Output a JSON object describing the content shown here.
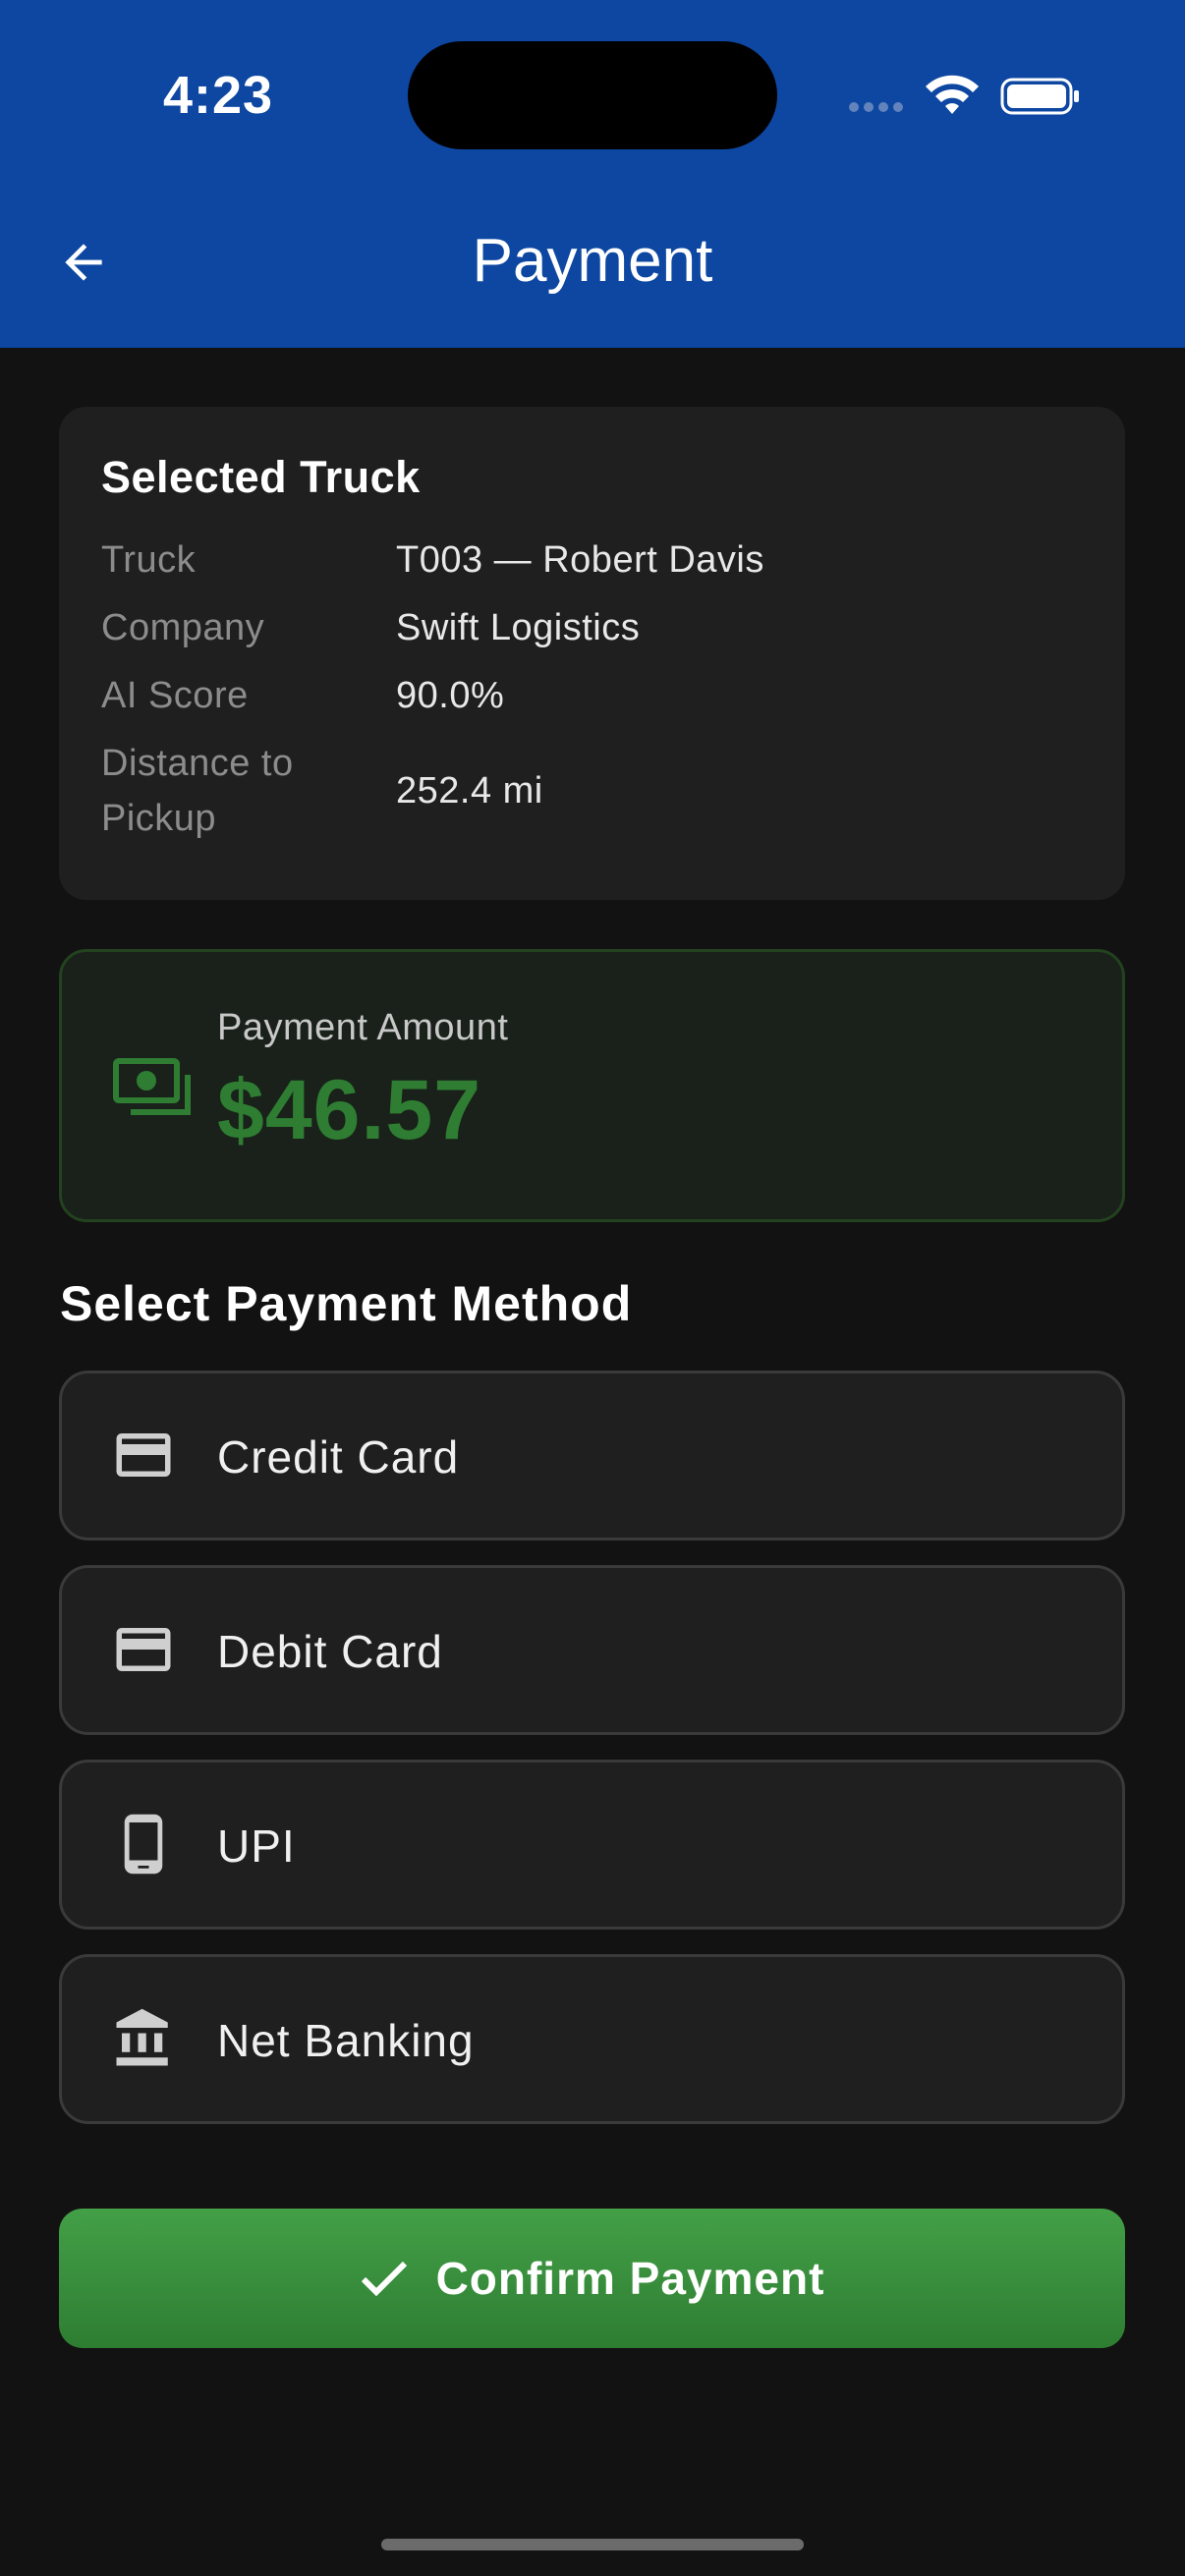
{
  "status_bar": {
    "time": "4:23"
  },
  "appbar": {
    "title": "Payment",
    "back_icon": "arrow-left-icon"
  },
  "truck_card": {
    "title": "Selected Truck",
    "rows": [
      {
        "label": "Truck",
        "value": "T003 — Robert Davis"
      },
      {
        "label": "Company",
        "value": "Swift Logistics"
      },
      {
        "label": "AI Score",
        "value": "90.0%"
      },
      {
        "label": "Distance to",
        "label2": "Pickup",
        "value": "252.4 mi"
      }
    ]
  },
  "payment_amount": {
    "label": "Payment Amount",
    "value": "$46.57",
    "icon": "money-icon"
  },
  "methods_title": "Select Payment Method",
  "methods": [
    {
      "label": "Credit Card",
      "icon": "credit-card-icon"
    },
    {
      "label": "Debit Card",
      "icon": "credit-card-icon"
    },
    {
      "label": "UPI",
      "icon": "smartphone-icon"
    },
    {
      "label": "Net Banking",
      "icon": "bank-icon"
    }
  ],
  "confirm_button": {
    "label": "Confirm Payment",
    "icon": "check-icon"
  },
  "colors": {
    "appbar": "#0d47a1",
    "background": "#121212",
    "card": "#1f1f1f",
    "accent_green": "#2e7d32",
    "button_green": "#43a047"
  }
}
